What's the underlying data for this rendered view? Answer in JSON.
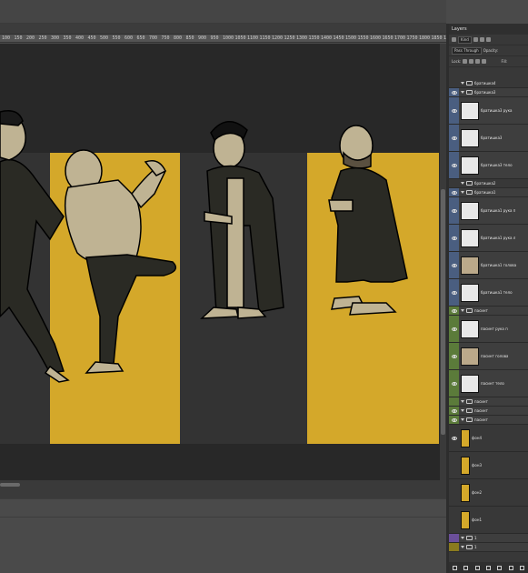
{
  "ruler": {
    "ticks": [
      "100",
      "150",
      "200",
      "250",
      "300",
      "350",
      "400",
      "450",
      "500",
      "550",
      "600",
      "650",
      "700",
      "750",
      "800",
      "850",
      "900",
      "950",
      "1000",
      "1050",
      "1100",
      "1150",
      "1200",
      "1250",
      "1300",
      "1350",
      "1400",
      "1450",
      "1500",
      "1550",
      "1600",
      "1650",
      "1700",
      "1750",
      "1800",
      "1850",
      "1900"
    ]
  },
  "layers_panel": {
    "tab_label": "Layers",
    "kind_label": "Kind",
    "blend_mode": "Pass Through",
    "opacity_label": "Opacity:",
    "lock_label": "Lock:",
    "fill_label": "Fill:",
    "rows": [
      {
        "name": "братишка4",
        "type": "group",
        "color": "#383838",
        "visible": false,
        "height": 10
      },
      {
        "name": "братишка3",
        "type": "group",
        "color": "#4a5e80",
        "visible": true,
        "height": 10
      },
      {
        "name": "братишка3 рука",
        "type": "layer",
        "color": "#4a5e80",
        "visible": true,
        "height": 30
      },
      {
        "name": "братишка3",
        "type": "layer",
        "color": "#4a5e80",
        "visible": true,
        "height": 30
      },
      {
        "name": "братишка3 тело",
        "type": "layer",
        "color": "#4a5e80",
        "visible": true,
        "height": 30
      },
      {
        "name": "братишка2",
        "type": "group",
        "color": "#383838",
        "visible": false,
        "height": 10
      },
      {
        "name": "братишка1",
        "type": "group",
        "color": "#4a5e80",
        "visible": true,
        "height": 10
      },
      {
        "name": "братишка1 рука п",
        "type": "layer",
        "color": "#4a5e80",
        "visible": true,
        "height": 30
      },
      {
        "name": "братишка1 рука л",
        "type": "layer",
        "color": "#4a5e80",
        "visible": true,
        "height": 30
      },
      {
        "name": "братишка1 голова",
        "type": "layer",
        "color": "#4a5e80",
        "visible": true,
        "height": 30
      },
      {
        "name": "братишка1 тело",
        "type": "layer",
        "color": "#4a5e80",
        "visible": true,
        "height": 30
      },
      {
        "name": "пасинт",
        "type": "group",
        "color": "#5b7b3a",
        "visible": true,
        "height": 10
      },
      {
        "name": "пасинт рука п",
        "type": "layer",
        "color": "#5b7b3a",
        "visible": true,
        "height": 30
      },
      {
        "name": "пасинт голова",
        "type": "layer",
        "color": "#5b7b3a",
        "visible": true,
        "height": 30
      },
      {
        "name": "пасинт тело",
        "type": "layer",
        "color": "#5b7b3a",
        "visible": true,
        "height": 30
      },
      {
        "name": "пасинт",
        "type": "group",
        "color": "#5b7b3a",
        "visible": false,
        "height": 10
      },
      {
        "name": "пасинт",
        "type": "group",
        "color": "#5b7b3a",
        "visible": true,
        "height": 10
      },
      {
        "name": "пасинт",
        "type": "group",
        "color": "#5b7b3a",
        "visible": true,
        "height": 10
      },
      {
        "name": "фон4",
        "type": "fill",
        "color": "#383838",
        "visible": true,
        "height": 30
      },
      {
        "name": "фон3",
        "type": "fill",
        "color": "#383838",
        "visible": false,
        "height": 30
      },
      {
        "name": "фон2",
        "type": "fill",
        "color": "#383838",
        "visible": false,
        "height": 30
      },
      {
        "name": "фон1",
        "type": "fill",
        "color": "#383838",
        "visible": false,
        "height": 30
      },
      {
        "name": "1",
        "type": "group",
        "color": "#6b4f9a",
        "visible": false,
        "height": 10
      },
      {
        "name": "1",
        "type": "group",
        "color": "#8a7a1f",
        "visible": false,
        "height": 10
      }
    ]
  },
  "canvas": {
    "panels": [
      {
        "name": "panel-1",
        "fill": "#333333"
      },
      {
        "name": "panel-2",
        "fill": "#d4a82a"
      },
      {
        "name": "panel-3",
        "fill": "#333333"
      },
      {
        "name": "panel-4",
        "fill": "#d4a82a"
      }
    ]
  }
}
